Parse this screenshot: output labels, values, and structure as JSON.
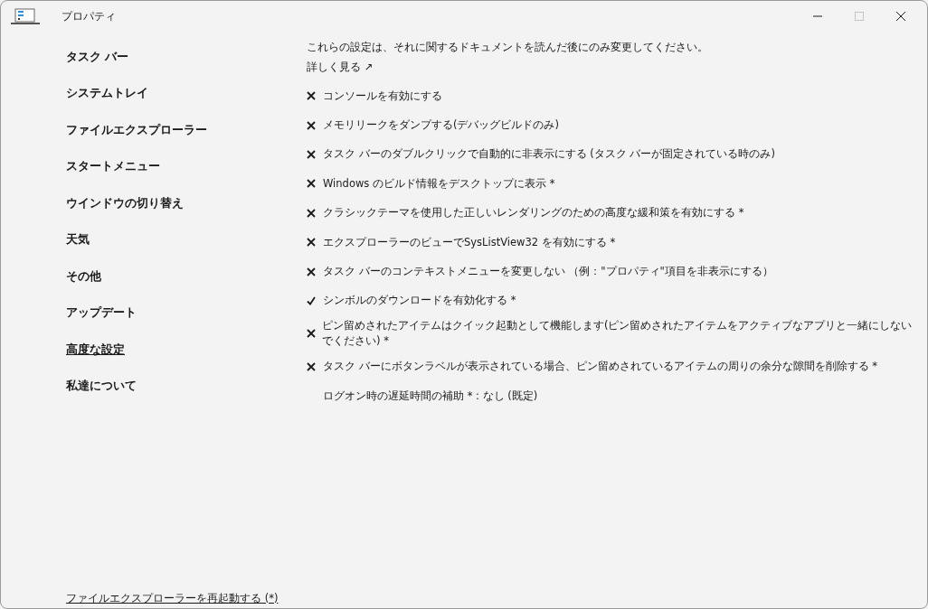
{
  "window": {
    "title": "プロパティ",
    "buttons": [
      {
        "kind": "minimize",
        "disabled": false
      },
      {
        "kind": "maximize",
        "disabled": true
      },
      {
        "kind": "close",
        "disabled": false
      }
    ]
  },
  "sidebar": {
    "items": [
      {
        "label": "タスク バー",
        "selected": false
      },
      {
        "label": "システムトレイ",
        "selected": false
      },
      {
        "label": "ファイルエクスプローラー",
        "selected": false
      },
      {
        "label": "スタートメニュー",
        "selected": false
      },
      {
        "label": "ウインドウの切り替え",
        "selected": false
      },
      {
        "label": "天気",
        "selected": false
      },
      {
        "label": "その他",
        "selected": false
      },
      {
        "label": "アップデート",
        "selected": false
      },
      {
        "label": "高度な設定",
        "selected": true
      },
      {
        "label": "私達について",
        "selected": false
      }
    ],
    "footer_link": "ファイルエクスプローラーを再起動する (*)"
  },
  "content": {
    "notice": "これらの設定は、それに関するドキュメントを読んだ後にのみ変更してください。",
    "learn_more": "詳しく見る ↗",
    "options": [
      {
        "kind": "toggle",
        "label": "コンソールを有効にする",
        "checked": false
      },
      {
        "kind": "toggle",
        "label": "メモリリークをダンプする(デバッグビルドのみ)",
        "checked": false
      },
      {
        "kind": "toggle",
        "label": "タスク バーのダブルクリックで自動的に非表示にする (タスク バーが固定されている時のみ)",
        "checked": false
      },
      {
        "kind": "toggle",
        "label": "Windows のビルド情報をデスクトップに表示 *",
        "checked": false
      },
      {
        "kind": "toggle",
        "label": "クラシックテーマを使用した正しいレンダリングのための高度な緩和策を有効にする *",
        "checked": false
      },
      {
        "kind": "toggle",
        "label": "エクスプローラーのビューでSysListView32 を有効にする *",
        "checked": false
      },
      {
        "kind": "toggle",
        "label": "タスク バーのコンテキストメニューを変更しない （例：\"プロパティ\"項目を非表示にする）",
        "checked": false
      },
      {
        "kind": "toggle",
        "label": "シンボルのダウンロードを有効化する *",
        "checked": true
      },
      {
        "kind": "toggle",
        "label": "ピン留めされたアイテムはクイック起動として機能します(ピン留めされたアイテムをアクティブなアプリと一緒にしないでください) *",
        "checked": false
      },
      {
        "kind": "toggle",
        "label": "タスク バーにボタンラベルが表示されている場合、ピン留めされているアイテムの周りの余分な隙間を削除する *",
        "checked": false
      },
      {
        "kind": "choice",
        "label": "ログオン時の遅延時間の補助 * : なし (既定)"
      }
    ]
  }
}
